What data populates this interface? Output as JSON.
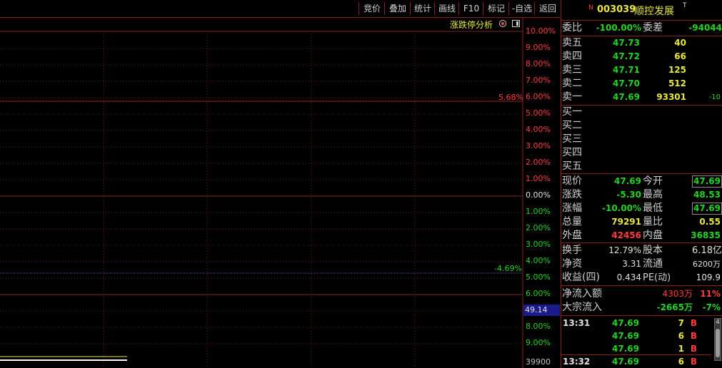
{
  "toolbar": {
    "buttons": [
      "竞价",
      "叠加",
      "统计",
      "画线",
      "F10",
      "标记",
      "-自选",
      "返回"
    ]
  },
  "chart": {
    "analysis_label": "涨跌停分析",
    "upper_pcts": [
      "10.00%",
      "9.00%",
      "8.00%",
      "7.00%",
      "6.00%",
      "5.00%",
      "4.00%",
      "3.00%",
      "2.00%",
      "1.00%"
    ],
    "zero_pct": "0.00%",
    "lower_pcts": [
      "1.00%",
      "2.00%",
      "3.00%",
      "4.00%",
      "5.00%",
      "6.00%",
      "7.00%",
      "8.00%",
      "9.00%"
    ],
    "high_marker": "5.68%",
    "low_marker": "-4.69%",
    "current_price_tag": "49.14",
    "volume_max": "39900",
    "colors": {
      "up": "#ff3b3b",
      "down": "#22d422",
      "grid": "#8a1f1f"
    }
  },
  "quote": {
    "badge": "N",
    "code": "003039",
    "name": "顺控发展",
    "suffix": "T",
    "weibi_label": "委比",
    "weibi_value": "-100.00%",
    "weicha_label": "委差",
    "weicha_value": "-94044",
    "sells": [
      {
        "label": "卖五",
        "price": "47.73",
        "vol": "40",
        "chg": ""
      },
      {
        "label": "卖四",
        "price": "47.72",
        "vol": "66",
        "chg": ""
      },
      {
        "label": "卖三",
        "price": "47.71",
        "vol": "125",
        "chg": ""
      },
      {
        "label": "卖二",
        "price": "47.70",
        "vol": "512",
        "chg": ""
      },
      {
        "label": "卖一",
        "price": "47.69",
        "vol": "93301",
        "chg": "-10"
      }
    ],
    "buys": [
      {
        "label": "买一"
      },
      {
        "label": "买二"
      },
      {
        "label": "买三"
      },
      {
        "label": "买四"
      },
      {
        "label": "买五"
      }
    ],
    "stats": [
      {
        "l1": "现价",
        "v1": "47.69",
        "l2": "今开",
        "v2": "47.69"
      },
      {
        "l1": "涨跌",
        "v1": "-5.30",
        "l2": "最高",
        "v2": "48.53"
      },
      {
        "l1": "涨幅",
        "v1": "-10.00%",
        "l2": "最低",
        "v2": "47.69"
      },
      {
        "l1": "总量",
        "v1": "79291",
        "l2": "量比",
        "v2": "0.55"
      },
      {
        "l1": "外盘",
        "v1": "42456",
        "l2": "内盘",
        "v2": "36835"
      }
    ],
    "fund": [
      {
        "l1": "换手",
        "v1": "12.79%",
        "l2": "股本",
        "v2": "6.18亿"
      },
      {
        "l1": "净资",
        "v1": "3.31",
        "l2": "流通",
        "v2": "6200万"
      },
      {
        "l1": "收益(四)",
        "v1": "0.434",
        "l2": "PE(动)",
        "v2": "109.9"
      }
    ],
    "flow": [
      {
        "label": "净流入额",
        "value": "4303万",
        "pct": "11%"
      },
      {
        "label": "大宗流入",
        "value": "-2665万",
        "pct": "-7%"
      }
    ],
    "ticks": [
      {
        "time": "13:31",
        "price": "47.69",
        "vol": "7",
        "dir": "B"
      },
      {
        "time": "",
        "price": "47.69",
        "vol": "6",
        "dir": "B"
      },
      {
        "time": "",
        "price": "47.69",
        "vol": "1",
        "dir": "B"
      },
      {
        "time": "13:32",
        "price": "47.69",
        "vol": "6",
        "dir": "B"
      }
    ],
    "tick_scroll_badge": "4"
  }
}
